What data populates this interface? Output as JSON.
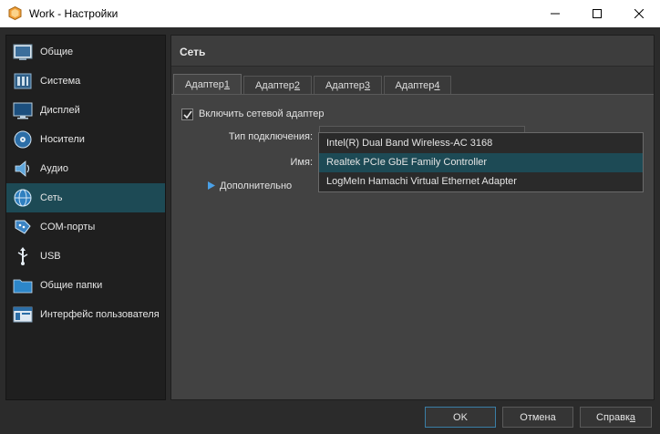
{
  "window": {
    "title": "Work - Настройки",
    "minimize_icon": "minimize-icon",
    "maximize_icon": "maximize-icon",
    "close_icon": "close-icon"
  },
  "sidebar": {
    "items": [
      {
        "label": "Общие",
        "icon": "general-icon"
      },
      {
        "label": "Система",
        "icon": "system-icon"
      },
      {
        "label": "Дисплей",
        "icon": "display-icon"
      },
      {
        "label": "Носители",
        "icon": "storage-icon"
      },
      {
        "label": "Аудио",
        "icon": "audio-icon"
      },
      {
        "label": "Сеть",
        "icon": "network-icon",
        "active": true
      },
      {
        "label": "COM-порты",
        "icon": "serial-ports-icon"
      },
      {
        "label": "USB",
        "icon": "usb-icon"
      },
      {
        "label": "Общие папки",
        "icon": "shared-folders-icon"
      },
      {
        "label": "Интерфейс пользователя",
        "icon": "user-interface-icon"
      }
    ]
  },
  "content": {
    "section_title": "Сеть",
    "tabs": [
      {
        "label_prefix": "Адаптер ",
        "label_accel": "1",
        "active": true
      },
      {
        "label_prefix": "Адаптер ",
        "label_accel": "2"
      },
      {
        "label_prefix": "Адаптер ",
        "label_accel": "3"
      },
      {
        "label_prefix": "Адаптер ",
        "label_accel": "4"
      }
    ],
    "enable_adapter": {
      "label": "Включить сетевой адаптер",
      "checked": true
    },
    "attached_to_label": "Тип подключения:",
    "name_label": "Имя:",
    "advanced_label": "Дополнительно",
    "name_options": [
      {
        "label": "Intel(R) Dual Band Wireless-AC 3168"
      },
      {
        "label": "Realtek PCIe GbE Family Controller",
        "selected": true
      },
      {
        "label": "LogMeIn Hamachi Virtual Ethernet Adapter"
      }
    ]
  },
  "buttons": {
    "ok": "OK",
    "cancel": "Отмена",
    "help_prefix": "Справк",
    "help_accel": "а"
  },
  "colors": {
    "selection": "#1d4a55",
    "accent_text": "#dcdcdc"
  }
}
